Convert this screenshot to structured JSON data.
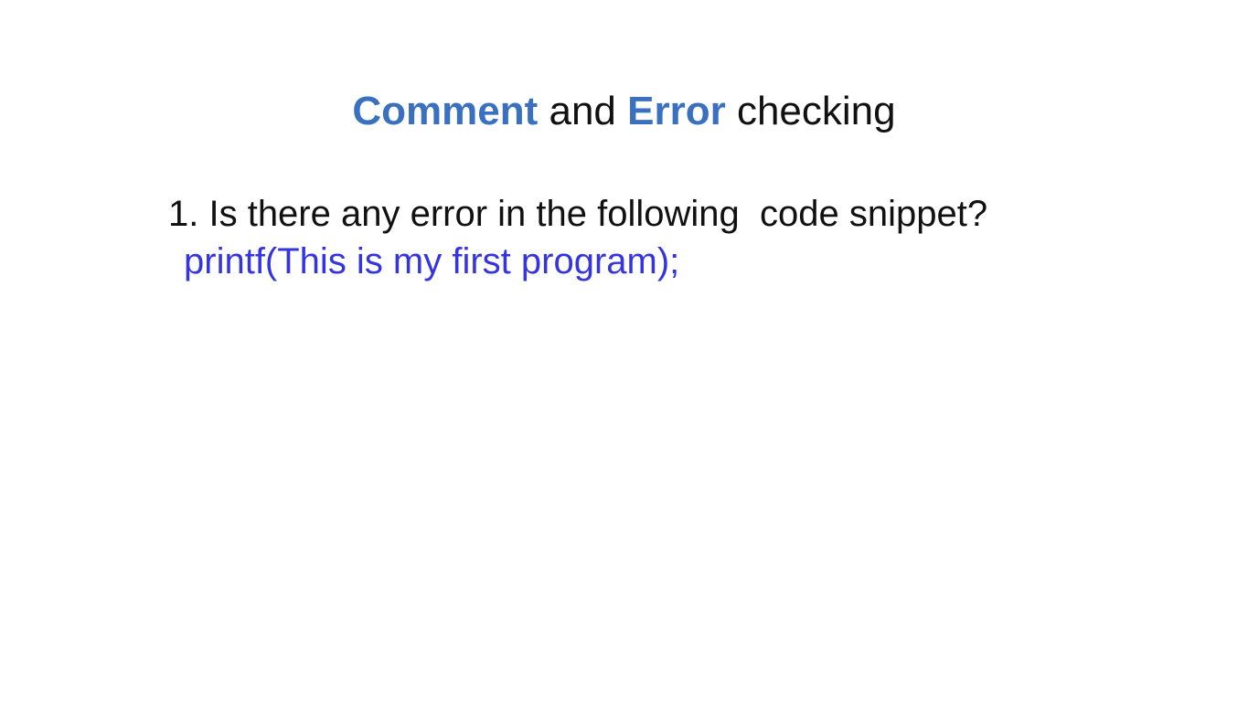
{
  "colors": {
    "accent": "#3a70c0",
    "code": "#3535e0",
    "text": "#111111",
    "background": "#ffffff"
  },
  "slide": {
    "title": {
      "word1": "Comment",
      "connector": " and ",
      "word2": "Error",
      "rest": " checking"
    },
    "question": "1. Is there any error in the following  code snippet?",
    "code": "printf(This is my first program);"
  }
}
